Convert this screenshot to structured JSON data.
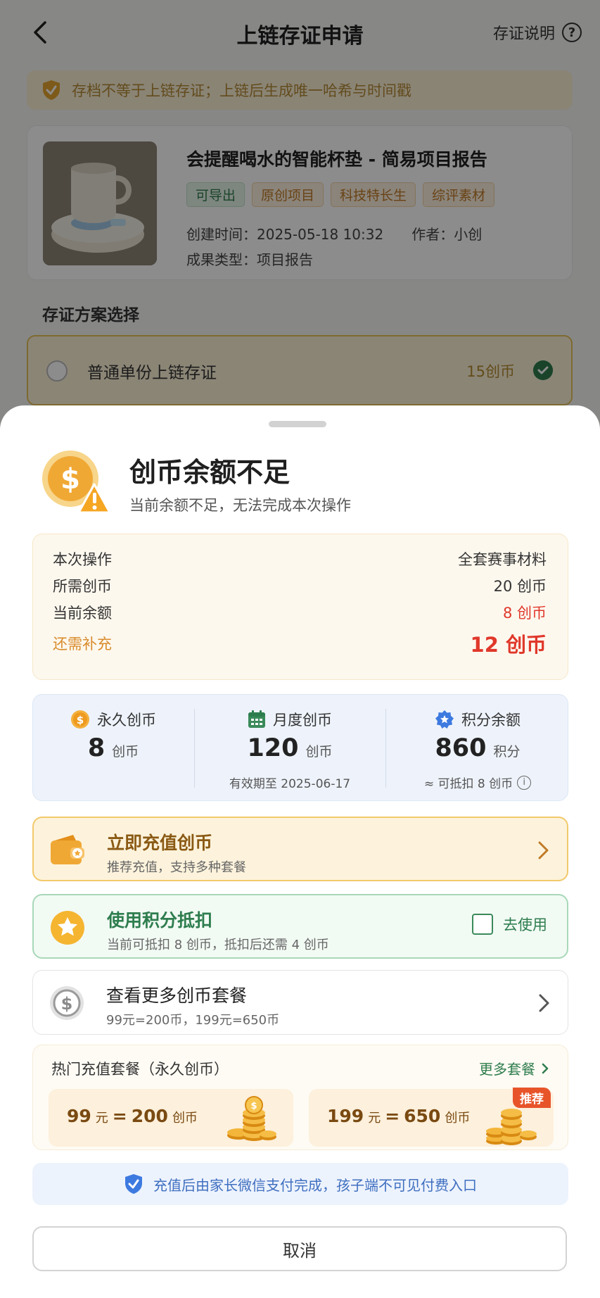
{
  "header": {
    "title": "上链存证申请",
    "help_label": "存证说明",
    "help_icon_text": "?"
  },
  "notice": {
    "text": "存档不等于上链存证；上链后生成唯一哈希与时间戳"
  },
  "project": {
    "title": "会提醒喝水的智能杯垫 - 简易项目报告",
    "tags": [
      "可导出",
      "原创项目",
      "科技特长生",
      "综评素材"
    ],
    "created": "创建时间：2025-05-18 10:32",
    "author": "作者：小创",
    "result_type": "成果类型：项目报告"
  },
  "plan_section": {
    "title": "存证方案选择",
    "plan_name": "普通单份上链存证",
    "plan_price": "15创币"
  },
  "sheet": {
    "title": "创币余额不足",
    "subtitle": "当前余额不足，无法完成本次操作",
    "details": [
      {
        "key": "本次操作",
        "value": "全套赛事材料"
      },
      {
        "key": "所需创币",
        "value": "20 创币"
      },
      {
        "key": "当前余额",
        "value": "8 创币"
      },
      {
        "key": "还需补充",
        "value": "12 创币"
      }
    ],
    "wallet": {
      "permanent": {
        "label": "永久创币",
        "amount": "8",
        "unit": "创币"
      },
      "monthly": {
        "label": "月度创币",
        "amount": "120",
        "unit": "创币",
        "note": "有效期至 2025-06-17"
      },
      "points": {
        "label": "积分余额",
        "amount": "860",
        "unit": "积分",
        "note": "≈ 可抵扣 8 创币",
        "info_icon_text": "i"
      }
    },
    "options": {
      "recharge": {
        "title": "立即充值创币",
        "subtitle": "推荐充值，支持多种套餐"
      },
      "points": {
        "title": "使用积分抵扣",
        "subtitle": "当前可抵扣 8 创币，抵扣后还需 4 创币",
        "action": "去使用"
      },
      "more": {
        "title": "查看更多创币套餐",
        "subtitle": "99元=200币，199元=650币"
      }
    },
    "hot": {
      "title": "热门充值套餐（永久创币）",
      "more_link": "更多套餐",
      "packages": [
        {
          "price": "99",
          "yuan": "元",
          "eq": "=",
          "coins": "200",
          "unit": "创币"
        },
        {
          "price": "199",
          "yuan": "元",
          "eq": "=",
          "coins": "650",
          "unit": "创币",
          "badge": "推荐"
        }
      ]
    },
    "tip": "充值后由家长微信支付完成，孩子端不可见付费入口",
    "cancel_label": "取消"
  },
  "colors": {
    "accent_green": "#2e7d4e",
    "warn_red": "#e0382b",
    "accent_orange": "#d98b2c",
    "info_blue": "#3f6fc0"
  }
}
